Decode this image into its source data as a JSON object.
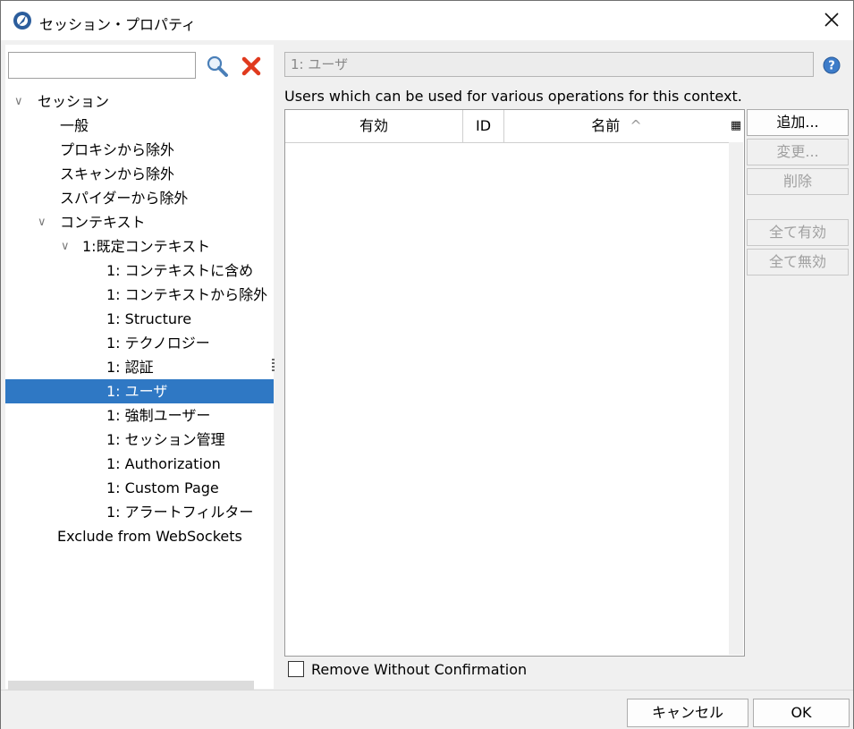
{
  "window": {
    "title": "セッション・プロパティ"
  },
  "left": {
    "search": {
      "value": "",
      "placeholder": ""
    },
    "tree": [
      {
        "label": "セッション",
        "expanded": true
      },
      {
        "label": "一般"
      },
      {
        "label": "プロキシから除外"
      },
      {
        "label": "スキャンから除外"
      },
      {
        "label": "スパイダーから除外"
      },
      {
        "label": "コンテキスト",
        "expanded": true
      },
      {
        "label": "1:既定コンテキスト",
        "expanded": true
      },
      {
        "label": "1: コンテキストに含め"
      },
      {
        "label": "1: コンテキストから除外"
      },
      {
        "label": "1: Structure"
      },
      {
        "label": "1: テクノロジー"
      },
      {
        "label": "1: 認証"
      },
      {
        "label": "1: ユーザ",
        "selected": true
      },
      {
        "label": "1: 強制ユーザー"
      },
      {
        "label": "1: セッション管理"
      },
      {
        "label": "1: Authorization"
      },
      {
        "label": "1: Custom Page"
      },
      {
        "label": "1: アラートフィルター"
      },
      {
        "label": "Exclude from WebSockets"
      }
    ]
  },
  "panel": {
    "title": "1: ユーザ",
    "description": "Users which can be used for various operations for this context.",
    "table": {
      "columns": [
        "有効",
        "ID",
        "名前"
      ],
      "sort_indicator": "^",
      "rows": []
    },
    "buttons": {
      "add": "追加...",
      "modify": "変更...",
      "remove": "削除",
      "enable_all": "全て有効",
      "disable_all": "全て無効"
    },
    "remove_without_confirmation": {
      "label": "Remove Without Confirmation",
      "checked": false
    }
  },
  "footer": {
    "cancel": "キャンセル",
    "ok": "OK"
  },
  "colors": {
    "selection": "#2f78c4",
    "help_icon": "#3d7cc9",
    "clear_icon": "#e03a1e"
  }
}
